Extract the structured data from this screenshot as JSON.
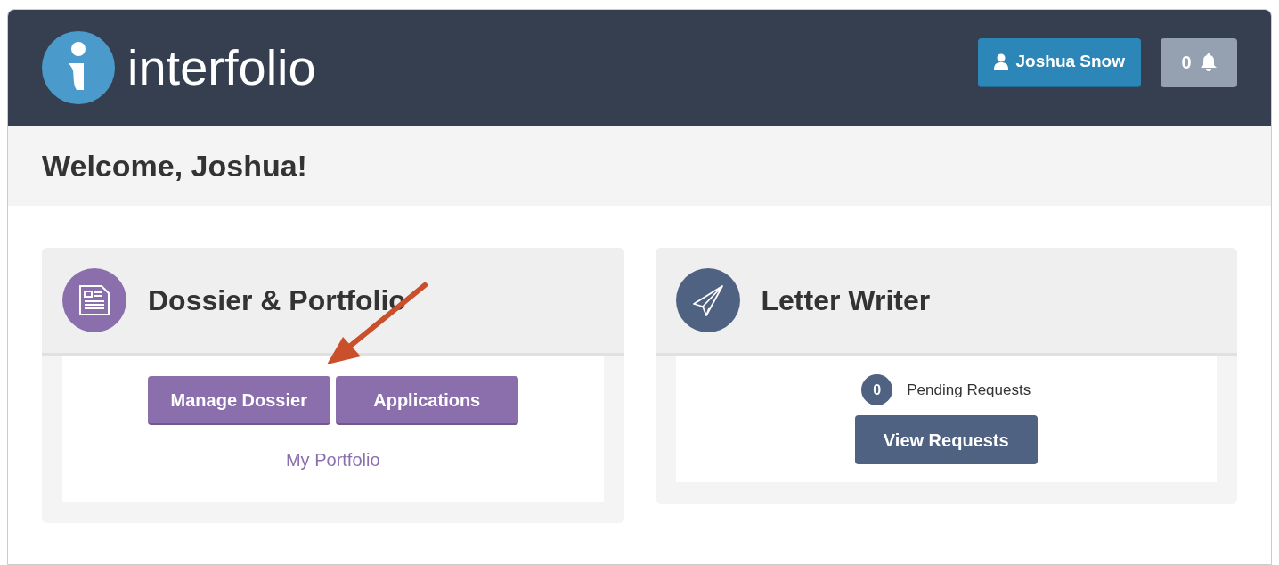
{
  "header": {
    "logo_text": "interfolio",
    "user_button": "Joshua Snow",
    "notifications": "0"
  },
  "welcome": "Welcome, Joshua!",
  "cards": [
    {
      "kind": "dossier",
      "title": "Dossier & Portfolio",
      "color": "#8b6fad",
      "buttons": [
        "Manage Dossier",
        "Applications"
      ],
      "link": "My Portfolio"
    },
    {
      "kind": "letters",
      "title": "Letter Writer",
      "color": "#4f6282",
      "pending_count": "0",
      "pending_label": "Pending Requests",
      "button": "View Requests"
    }
  ]
}
